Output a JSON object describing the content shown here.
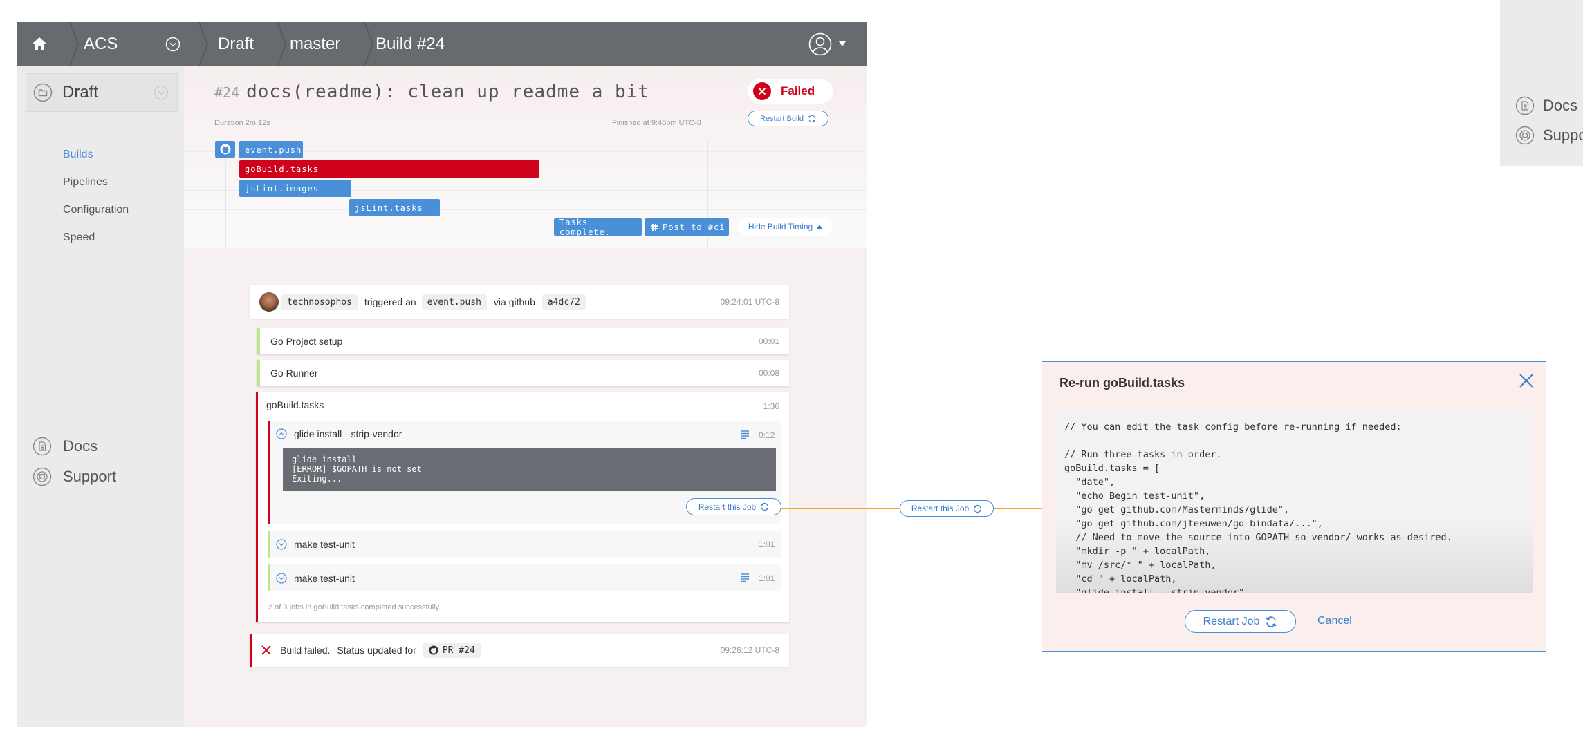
{
  "topbar": {
    "project": "ACS",
    "crumbs": [
      "Draft",
      "master",
      "Build #24"
    ]
  },
  "sidebar": {
    "project_label": "Draft",
    "items": [
      {
        "label": "Builds",
        "active": true
      },
      {
        "label": "Pipelines",
        "active": false
      },
      {
        "label": "Configuration",
        "active": false
      },
      {
        "label": "Speed",
        "active": false
      }
    ],
    "footer": [
      {
        "label": "Docs",
        "icon": "document-icon"
      },
      {
        "label": "Support",
        "icon": "lifebuoy-icon"
      }
    ]
  },
  "build": {
    "number": "#24",
    "title": "docs(readme): clean up readme a bit",
    "duration": "Duration 2m 12s",
    "finished": "Finished at 9:46pm UTC-8",
    "status": "Failed",
    "restart_label": "Restart Build",
    "hide_timing_label": "Hide Build Timing"
  },
  "timeline": {
    "bars": [
      {
        "label": "event.push",
        "color": "#4a90d9"
      },
      {
        "label": "goBuild.tasks",
        "color": "#d0021b"
      },
      {
        "label": "jsLint.images",
        "color": "#4a90d9"
      },
      {
        "label": "jsLint.tasks",
        "color": "#4a90d9"
      },
      {
        "label": "Tasks complete.",
        "color": "#4a90d9"
      },
      {
        "label": "Post to #ci",
        "color": "#4a90d9"
      }
    ]
  },
  "trigger": {
    "user": "technosophos",
    "verb": "triggered an",
    "event": "event.push",
    "via": "via github",
    "commit": "a4dc72",
    "time": "09:24:01 UTC-8"
  },
  "jobs": [
    {
      "name": "Go Project setup",
      "time": "00:01",
      "status": "success"
    },
    {
      "name": "Go Runner",
      "time": "00:08",
      "status": "success"
    }
  ],
  "gobuild": {
    "name": "goBuild.tasks",
    "time": "1:36",
    "failed_job": {
      "name": "glide install --strip-vendor",
      "time": "0:12",
      "log": "glide install\n[ERROR] $GOPATH is not set\nExiting...",
      "restart_label": "Restart this Job"
    },
    "subjobs": [
      {
        "name": "make test-unit",
        "time": "1:01",
        "has_log": false
      },
      {
        "name": "make test-unit",
        "time": "1:01",
        "has_log": true
      }
    ],
    "summary": "2 of 3 jobs in goBuild.tasks completed successfully."
  },
  "failure": {
    "text": "Build failed.",
    "status_text": "Status updated for",
    "pr": "PR #24",
    "time": "09:26:12 UTC-8"
  },
  "connector": {
    "label": "Restart this Job",
    "color": "#f5a623"
  },
  "modal": {
    "title": "Re-run goBuild.tasks",
    "code": "// You can edit the task config before re-running if needed:\n\n// Run three tasks in order.\ngoBuild.tasks = [\n  \"date\",\n  \"echo Begin test-unit\",\n  \"go get github.com/Masterminds/glide\",\n  \"go get github.com/jteeuwen/go-bindata/...\",\n  // Need to move the source into GOPATH so vendor/ works as desired.\n  \"mkdir -p \" + localPath,\n  \"mv /src/* \" + localPath,\n  \"cd \" + localPath,\n  \"glide install --strip-vendor\"",
    "restart_label": "Restart Job",
    "cancel_label": "Cancel"
  },
  "partial_panel": {
    "items": [
      "Docs",
      "Suppo"
    ]
  },
  "colors": {
    "accent": "#4a90d9",
    "danger": "#d0021b",
    "success": "#b8e986",
    "connector": "#f5a623"
  }
}
